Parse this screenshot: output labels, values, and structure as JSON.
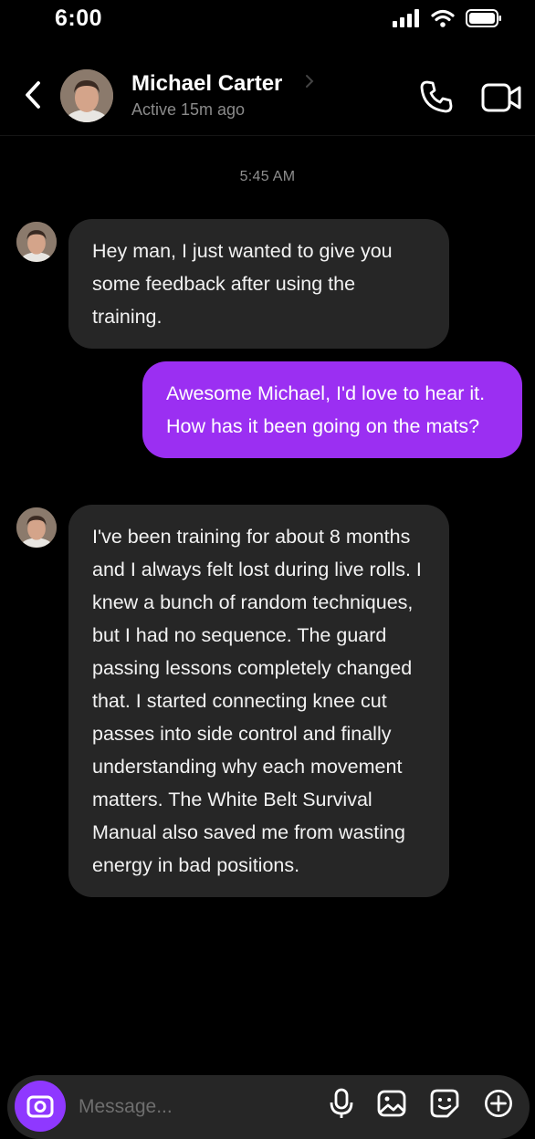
{
  "status_bar": {
    "time": "6:00",
    "icons": [
      "cellular-signal-icon",
      "wifi-icon",
      "battery-icon"
    ]
  },
  "header": {
    "contact_name": "Michael Carter",
    "active_status": "Active 15m ago",
    "icons": [
      "back-chevron-icon",
      "avatar",
      "chevron-right-icon",
      "phone-icon",
      "video-camera-icon"
    ]
  },
  "conversation": {
    "timestamp": "5:45 AM",
    "messages": [
      {
        "direction": "incoming",
        "text": "Hey man, I just wanted to give you some feedback after using the training."
      },
      {
        "direction": "outgoing",
        "text": "Awesome Michael, I'd love to hear it. How has it been going on the mats?"
      },
      {
        "direction": "incoming",
        "text": "I've been training for about 8 months and I always felt lost during live rolls. I knew a bunch of random techniques, but I had no sequence. The guard passing lessons completely changed that. I started connecting knee cut passes into side control and finally understanding why each movement matters. The White Belt Survival Manual also saved me from wasting energy in bad positions."
      }
    ]
  },
  "composer": {
    "placeholder": "Message...",
    "value": "",
    "icons": [
      "camera-icon",
      "microphone-icon",
      "gallery-icon",
      "sticker-icon",
      "plus-circle-icon"
    ]
  },
  "colors": {
    "background": "#000000",
    "incoming_bubble": "#262626",
    "outgoing_bubble": "#9b2ff2",
    "camera_button": "#8f38ff",
    "secondary_text": "#8a8a8a"
  }
}
